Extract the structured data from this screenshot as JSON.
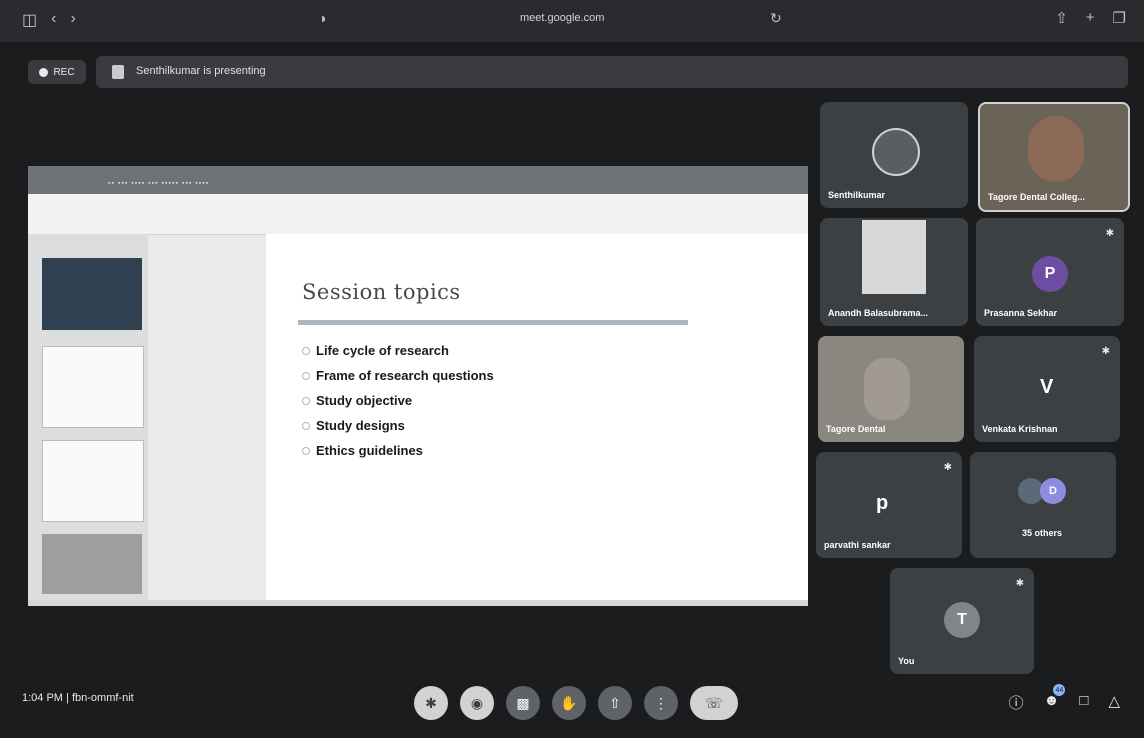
{
  "browser": {
    "url": "meet.google.com",
    "left_icons": [
      "sidebar-icon",
      "back-icon",
      "forward-icon"
    ],
    "right_icons": [
      "share-icon",
      "new-tab-icon",
      "tabs-icon"
    ]
  },
  "recording": {
    "label": "REC"
  },
  "banner": {
    "text": "Senthilkumar is presenting"
  },
  "presentation": {
    "slide_title": "Session topics",
    "bullets": [
      "Life cycle of research",
      "Frame of research questions",
      "Study objective",
      "Study designs",
      "Ethics guidelines"
    ]
  },
  "participants": [
    {
      "name": "Senthilkumar"
    },
    {
      "name": "Tagore Dental Colleg..."
    },
    {
      "name": "Anandh Balasubrama..."
    },
    {
      "name": "Prasanna Sekhar",
      "initial": "P",
      "avatar_color": "#6e4ea3"
    },
    {
      "name": "Tagore Dental"
    },
    {
      "name": "Venkata Krishnan",
      "initial": "V"
    },
    {
      "name": "parvathi sankar",
      "initial": "p"
    },
    {
      "name": "35 others"
    },
    {
      "name": "You",
      "initial": "T",
      "avatar_color": "#7f8589"
    }
  ],
  "meeting": {
    "time": "1:04 PM",
    "code": "fbn-ommf-nit"
  },
  "controls": [
    "mic-off-icon",
    "camera-off-icon",
    "captions-icon",
    "raise-hand-icon",
    "present-icon",
    "more-options-icon",
    "end-call-icon"
  ],
  "right_controls": {
    "participants_count": "44"
  }
}
